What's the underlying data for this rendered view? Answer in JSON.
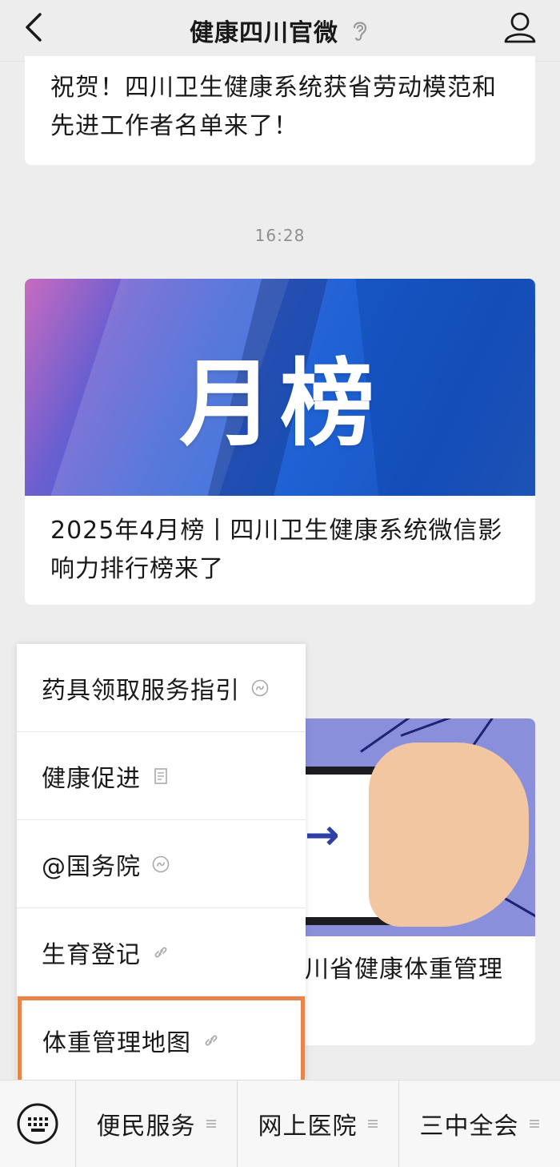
{
  "header": {
    "title": "健康四川官微"
  },
  "messages": [
    {
      "text": "祝贺！四川卫生健康系统获省劳动模范和先进工作者名单来了！"
    },
    {
      "time": "16:28",
      "banner_text": "月榜",
      "text": "2025年4月榜丨四川卫生健康系统微信影响力排行榜来了"
    },
    {
      "text": "川省健康体重管理"
    }
  ],
  "popup_menu": {
    "items": [
      {
        "label": "药具领取服务指引",
        "icon": "miniprogram-icon"
      },
      {
        "label": "健康促进",
        "icon": "article-icon"
      },
      {
        "label": "@国务院",
        "icon": "miniprogram-icon"
      },
      {
        "label": "生育登记",
        "icon": "link-icon"
      },
      {
        "label": "体重管理地图",
        "icon": "link-icon",
        "highlighted": true
      }
    ]
  },
  "bottom_menu": {
    "tabs": [
      {
        "label": "便民服务"
      },
      {
        "label": "网上医院"
      },
      {
        "label": "三中全会"
      }
    ]
  },
  "colors": {
    "highlight": "#e8844a",
    "background": "#ededed"
  }
}
